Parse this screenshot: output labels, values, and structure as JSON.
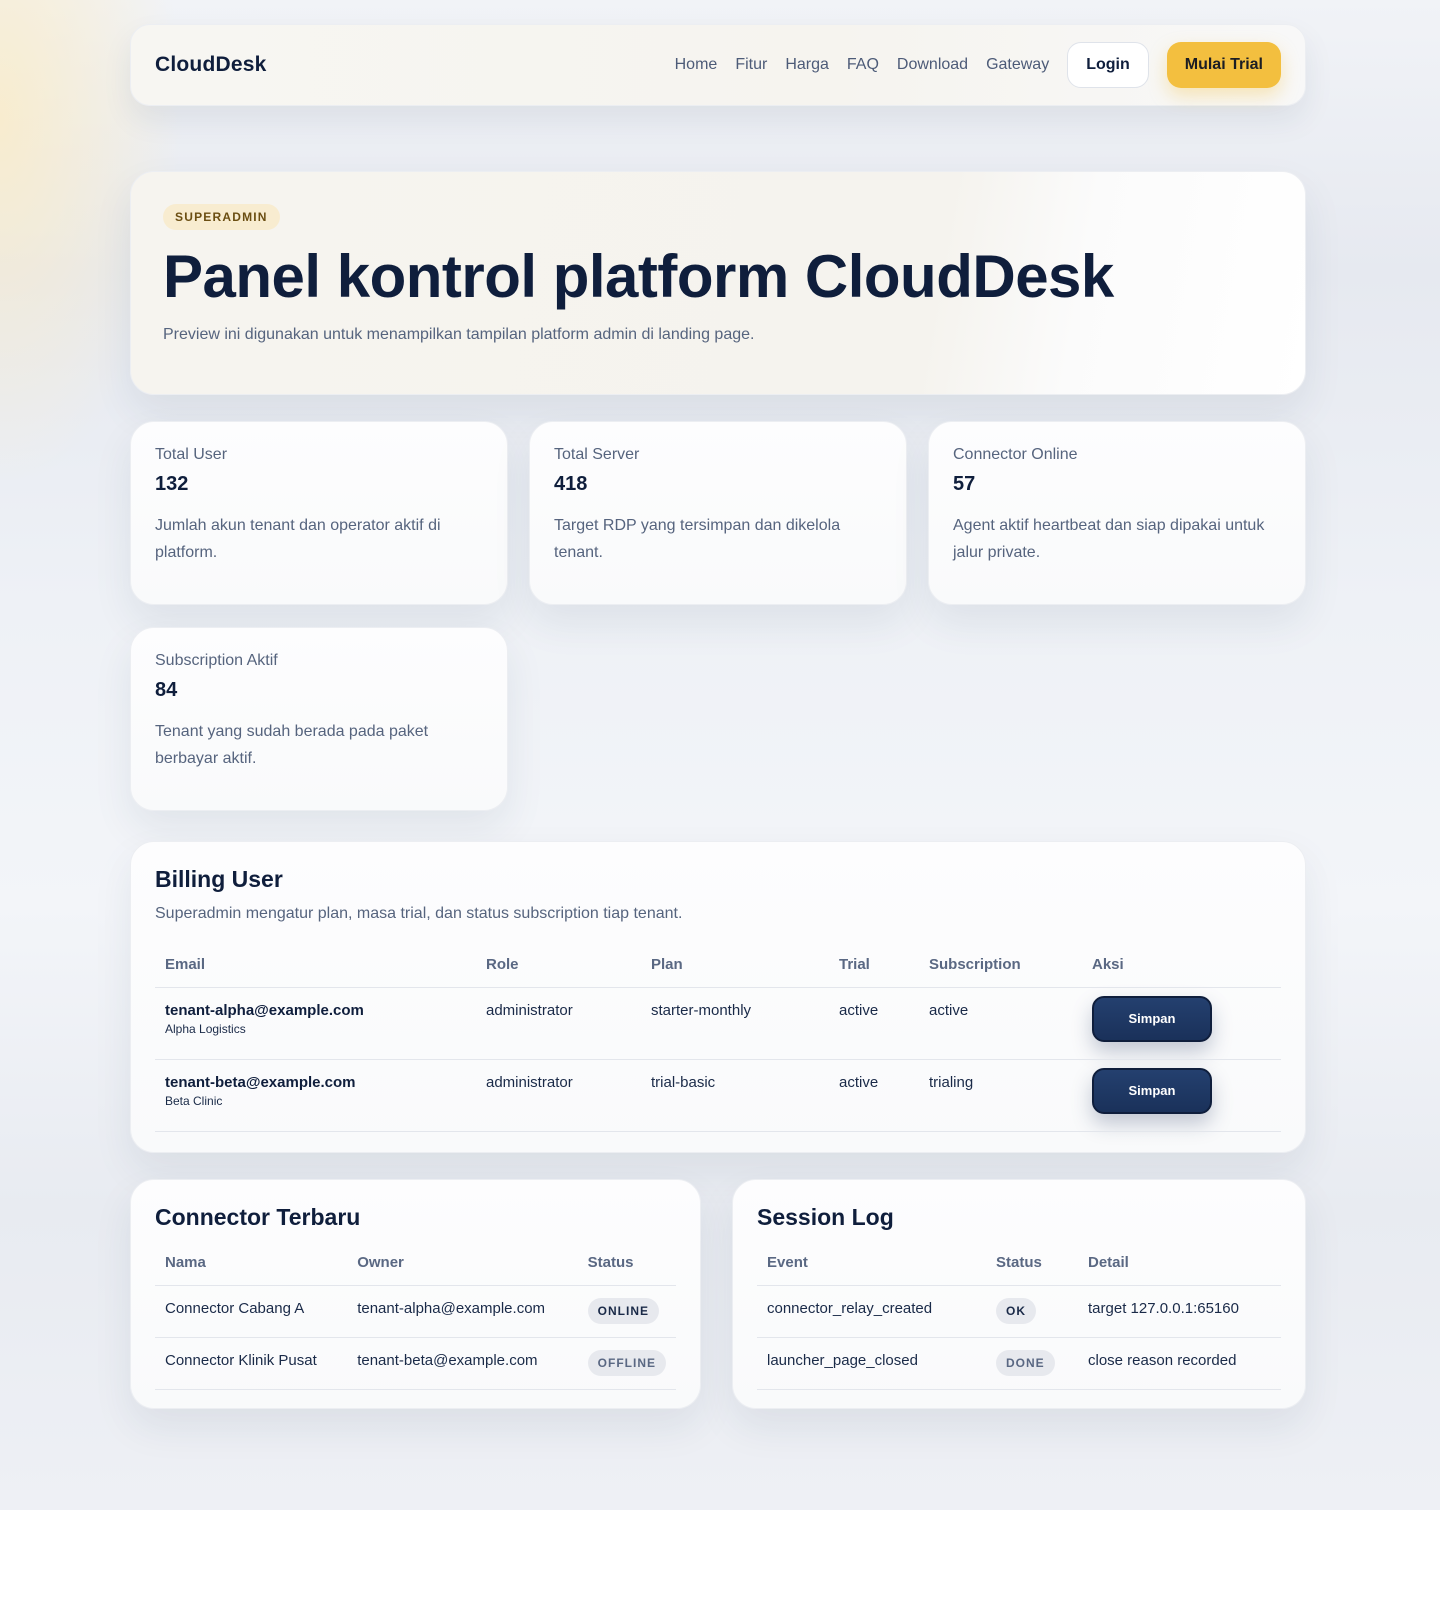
{
  "nav": {
    "brand": "CloudDesk",
    "links": [
      "Home",
      "Fitur",
      "Harga",
      "FAQ",
      "Download",
      "Gateway"
    ],
    "login": "Login",
    "trial": "Mulai Trial"
  },
  "hero": {
    "badge": "SUPERADMIN",
    "title": "Panel kontrol platform CloudDesk",
    "subtitle": "Preview ini digunakan untuk menampilkan tampilan platform admin di landing page."
  },
  "stats": [
    {
      "label": "Total User",
      "value": "132",
      "desc": "Jumlah akun tenant dan operator aktif di platform."
    },
    {
      "label": "Total Server",
      "value": "418",
      "desc": "Target RDP yang tersimpan dan dikelola tenant."
    },
    {
      "label": "Connector Online",
      "value": "57",
      "desc": "Agent aktif heartbeat dan siap dipakai untuk jalur private."
    },
    {
      "label": "Subscription Aktif",
      "value": "84",
      "desc": "Tenant yang sudah berada pada paket berbayar aktif."
    }
  ],
  "billing": {
    "title": "Billing User",
    "subtitle": "Superadmin mengatur plan, masa trial, dan status subscription tiap tenant.",
    "columns": [
      "Email",
      "Role",
      "Plan",
      "Trial",
      "Subscription",
      "Aksi"
    ],
    "rows": [
      {
        "email": "tenant-alpha@example.com",
        "company": "Alpha Logistics",
        "role": "administrator",
        "plan": "starter-monthly",
        "trial": "active",
        "subscription": "active",
        "action": "Simpan"
      },
      {
        "email": "tenant-beta@example.com",
        "company": "Beta Clinic",
        "role": "administrator",
        "plan": "trial-basic",
        "trial": "active",
        "subscription": "trialing",
        "action": "Simpan"
      }
    ]
  },
  "connectors": {
    "title": "Connector Terbaru",
    "columns": [
      "Nama",
      "Owner",
      "Status"
    ],
    "rows": [
      {
        "name": "Connector Cabang A",
        "owner": "tenant-alpha@example.com",
        "status": "ONLINE"
      },
      {
        "name": "Connector Klinik Pusat",
        "owner": "tenant-beta@example.com",
        "status": "OFFLINE"
      }
    ]
  },
  "sessions": {
    "title": "Session Log",
    "columns": [
      "Event",
      "Status",
      "Detail"
    ],
    "rows": [
      {
        "event": "connector_relay_created",
        "status": "OK",
        "detail": "target 127.0.0.1:65160"
      },
      {
        "event": "launcher_page_closed",
        "status": "DONE",
        "detail": "close reason recorded"
      }
    ]
  },
  "colors": {
    "accent": "#f3bf3f",
    "primary": "#1a315a",
    "text": "#0f1e3c",
    "muted": "#56647e"
  }
}
